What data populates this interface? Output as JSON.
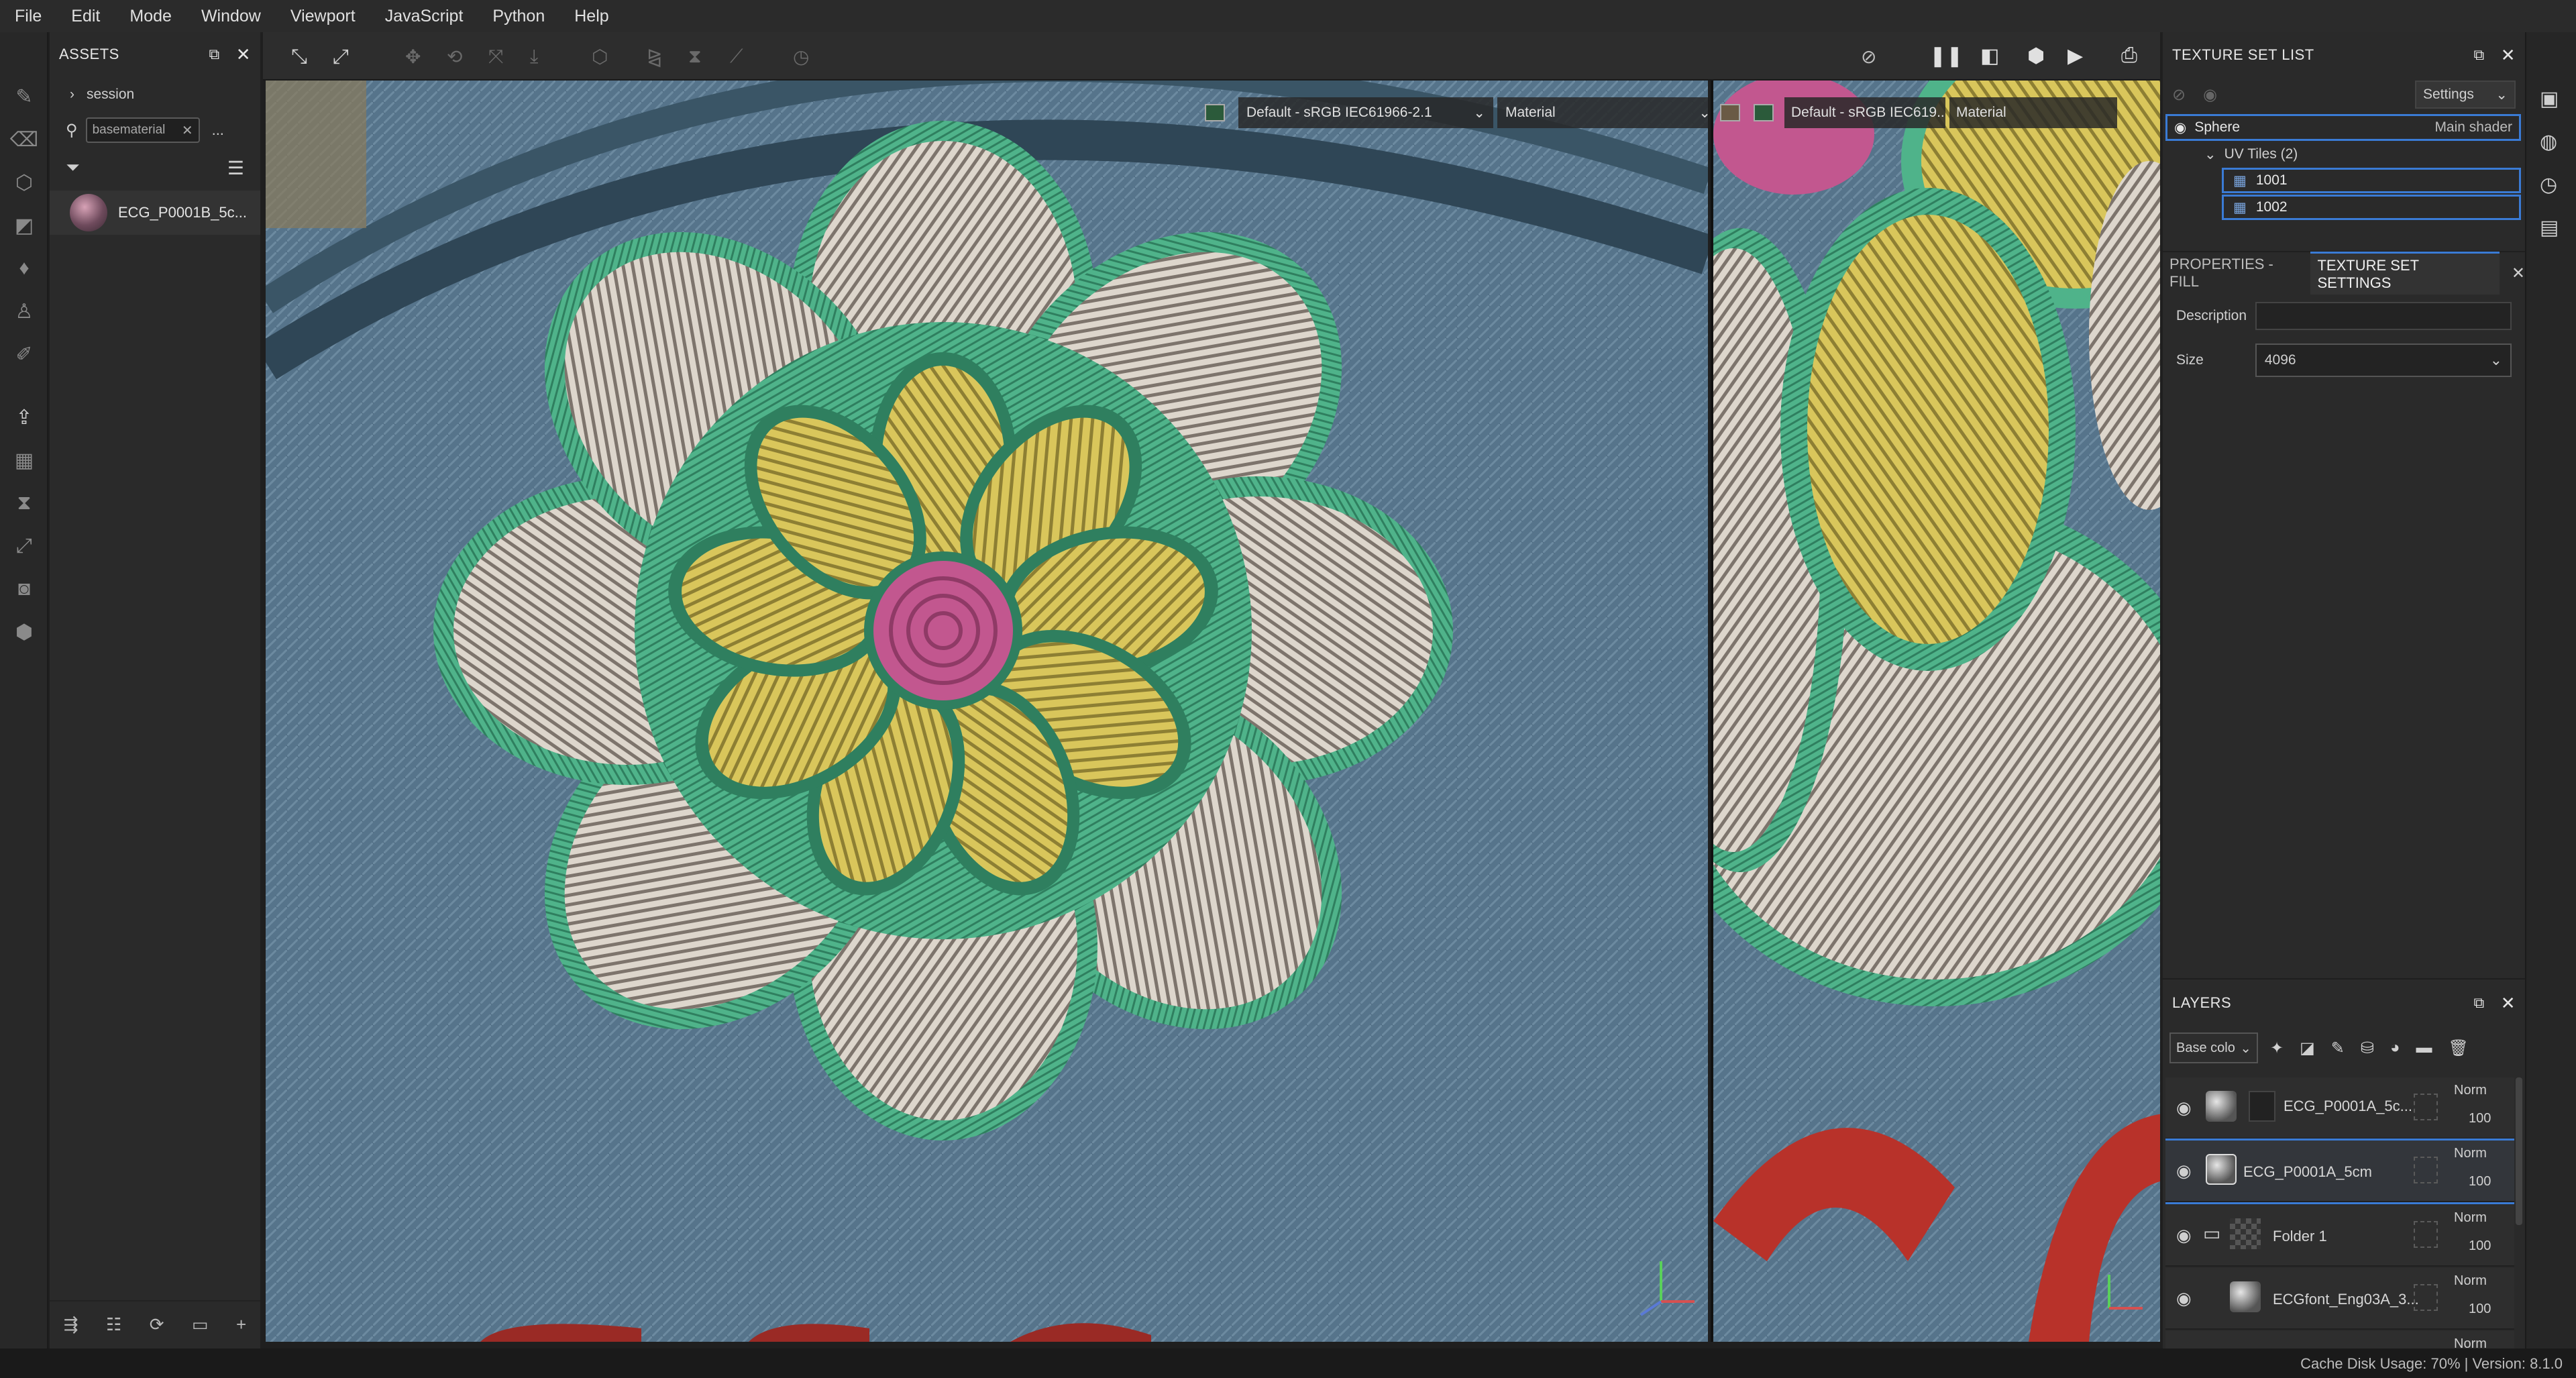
{
  "menu": [
    "File",
    "Edit",
    "Mode",
    "Window",
    "Viewport",
    "JavaScript",
    "Python",
    "Help"
  ],
  "assets": {
    "title": "ASSETS",
    "breadcrumb": "session",
    "search_value": "basematerial",
    "more": "...",
    "item_name": "ECG_P0001B_5c..."
  },
  "viewport": {
    "left_colorspace": "Default - sRGB IEC61966-2.1",
    "left_mode": "Material",
    "right_colorspace": "Default - sRGB IEC619...",
    "right_mode": "Material"
  },
  "texture_set_list": {
    "title": "TEXTURE SET LIST",
    "settings_label": "Settings",
    "set_name": "Sphere",
    "shader": "Main shader",
    "uv_tiles_label": "UV Tiles (2)",
    "tiles": [
      "1001",
      "1002"
    ]
  },
  "properties": {
    "tab_fill": "PROPERTIES - FILL",
    "tab_settings": "TEXTURE SET SETTINGS",
    "description_label": "Description",
    "description_value": "",
    "size_label": "Size",
    "size_value": "4096"
  },
  "layers": {
    "title": "LAYERS",
    "channel": "Base colo",
    "rows": [
      {
        "name": "ECG_P0001A_5c...",
        "blend": "Norm",
        "opacity": "100"
      },
      {
        "name": "ECG_P0001A_5cm",
        "blend": "Norm",
        "opacity": "100"
      },
      {
        "name": "Folder 1",
        "blend": "Norm",
        "opacity": "100"
      },
      {
        "name": "ECGfont_Eng03A_3...",
        "blend": "Norm",
        "opacity": "100"
      },
      {
        "name": "",
        "blend": "Norm",
        "opacity": ""
      }
    ]
  },
  "status": "Cache Disk Usage:  70% | Version: 8.1.0",
  "colors": {
    "accent": "#3a7bd5",
    "denim": "#55738a",
    "thread_green": "#4fb38a",
    "thread_yellow": "#d4c25a",
    "thread_pink": "#c2578f",
    "thread_white": "#e9e4dc",
    "thread_red": "#b8322a"
  }
}
